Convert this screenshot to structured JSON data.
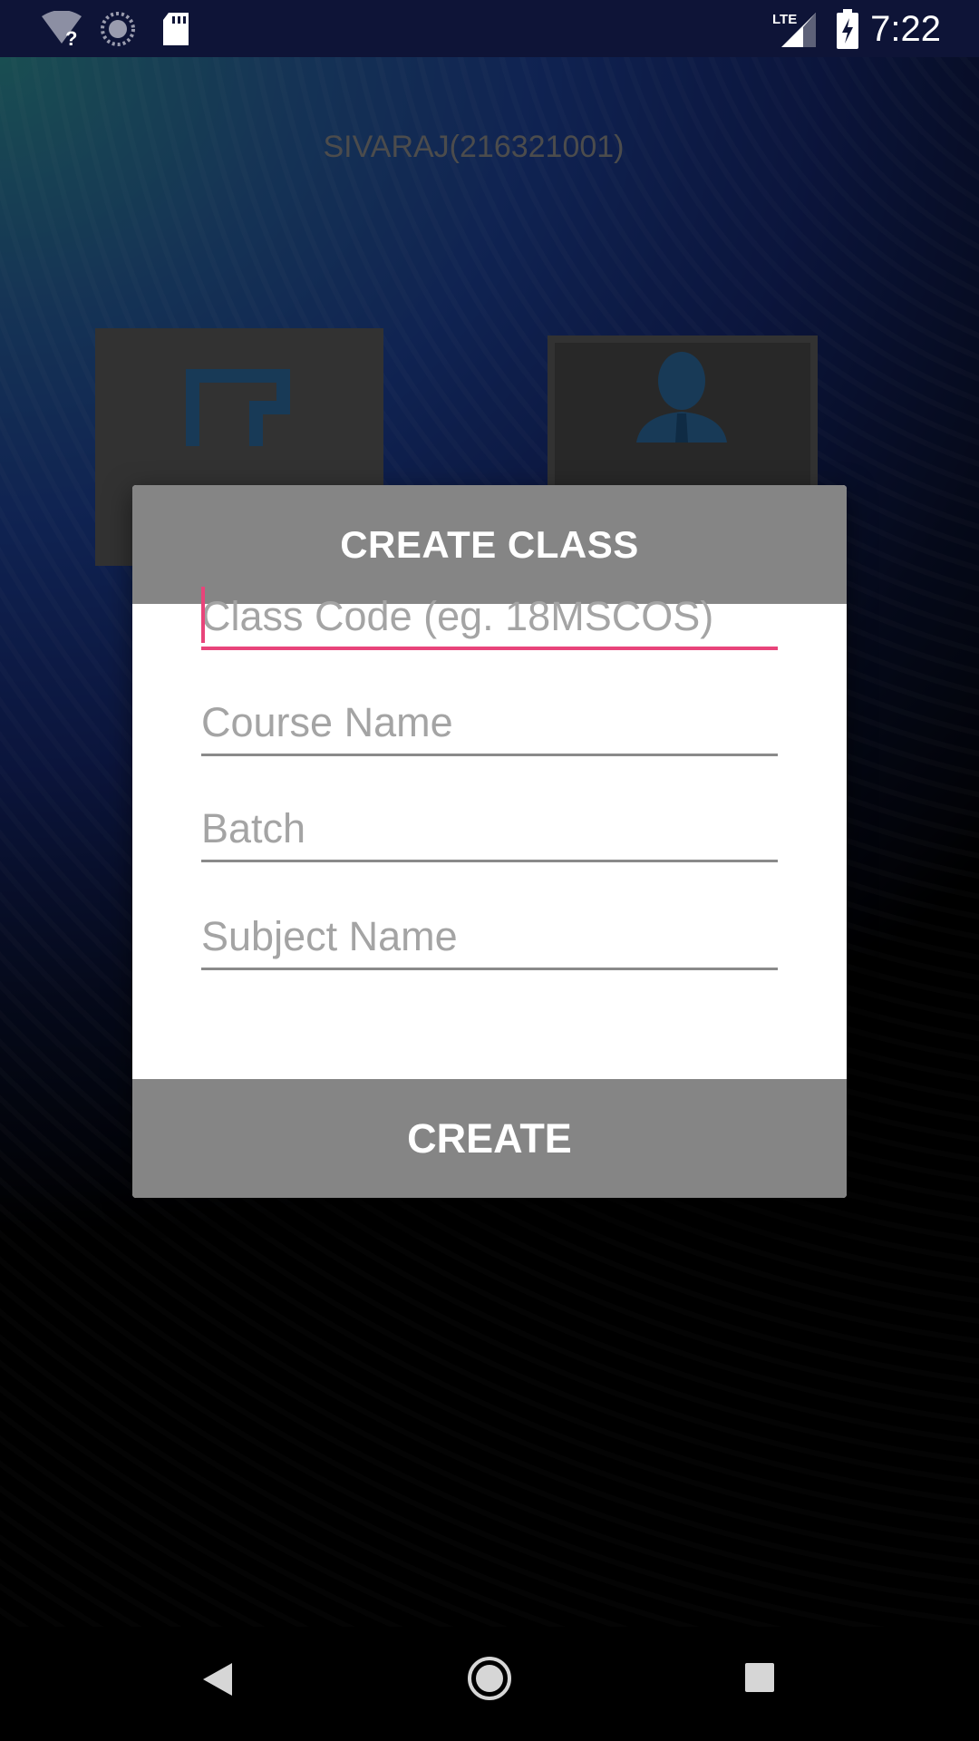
{
  "status_bar": {
    "time": "7:22",
    "network_label": "LTE",
    "icons": [
      "wifi-unknown-icon",
      "sync-icon",
      "sd-card-icon",
      "lte-signal-icon",
      "battery-charging-icon"
    ]
  },
  "background": {
    "user_label": "SIVARAJ(216321001)",
    "tiles": [
      "class-tile-icon",
      "profile-tile-icon"
    ]
  },
  "dialog": {
    "title": "CREATE CLASS",
    "fields": [
      {
        "placeholder": "Class Code (eg. 18MSCOS)",
        "value": ""
      },
      {
        "placeholder": "Course Name",
        "value": ""
      },
      {
        "placeholder": "Batch",
        "value": ""
      },
      {
        "placeholder": "Subject Name",
        "value": ""
      }
    ],
    "create_label": "CREATE"
  },
  "nav_bar": {
    "icons": [
      "back-icon",
      "home-icon",
      "recents-icon"
    ]
  },
  "colors": {
    "status_bar": "#0e1437",
    "dialog_header": "#858585",
    "focus_accent": "#e8447a",
    "placeholder": "#a4a4a4"
  }
}
